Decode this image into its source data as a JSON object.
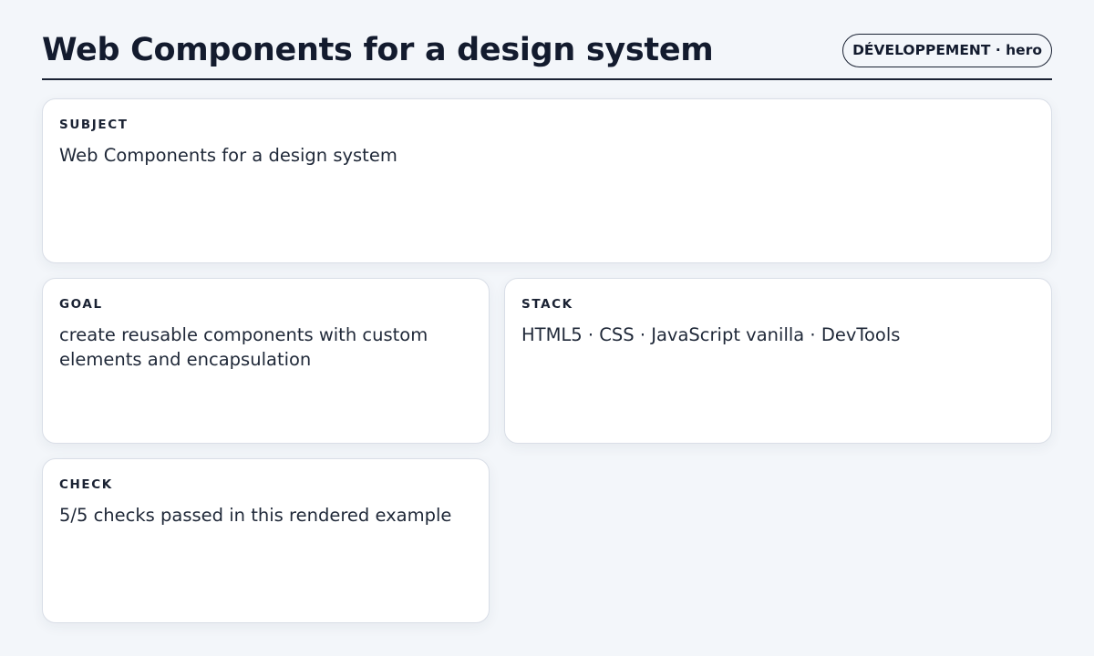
{
  "header": {
    "title": "Web Components for a design system",
    "badge": "DÉVELOPPEMENT · hero"
  },
  "cards": {
    "subject": {
      "label": "SUBJECT",
      "value": "Web Components for a design system"
    },
    "goal": {
      "label": "GOAL",
      "value": "create reusable components with custom elements and encapsulation"
    },
    "stack": {
      "label": "STACK",
      "value": "HTML5 · CSS · JavaScript vanilla · DevTools"
    },
    "check": {
      "label": "CHECK",
      "value": "5/5 checks passed in this rendered example"
    }
  }
}
